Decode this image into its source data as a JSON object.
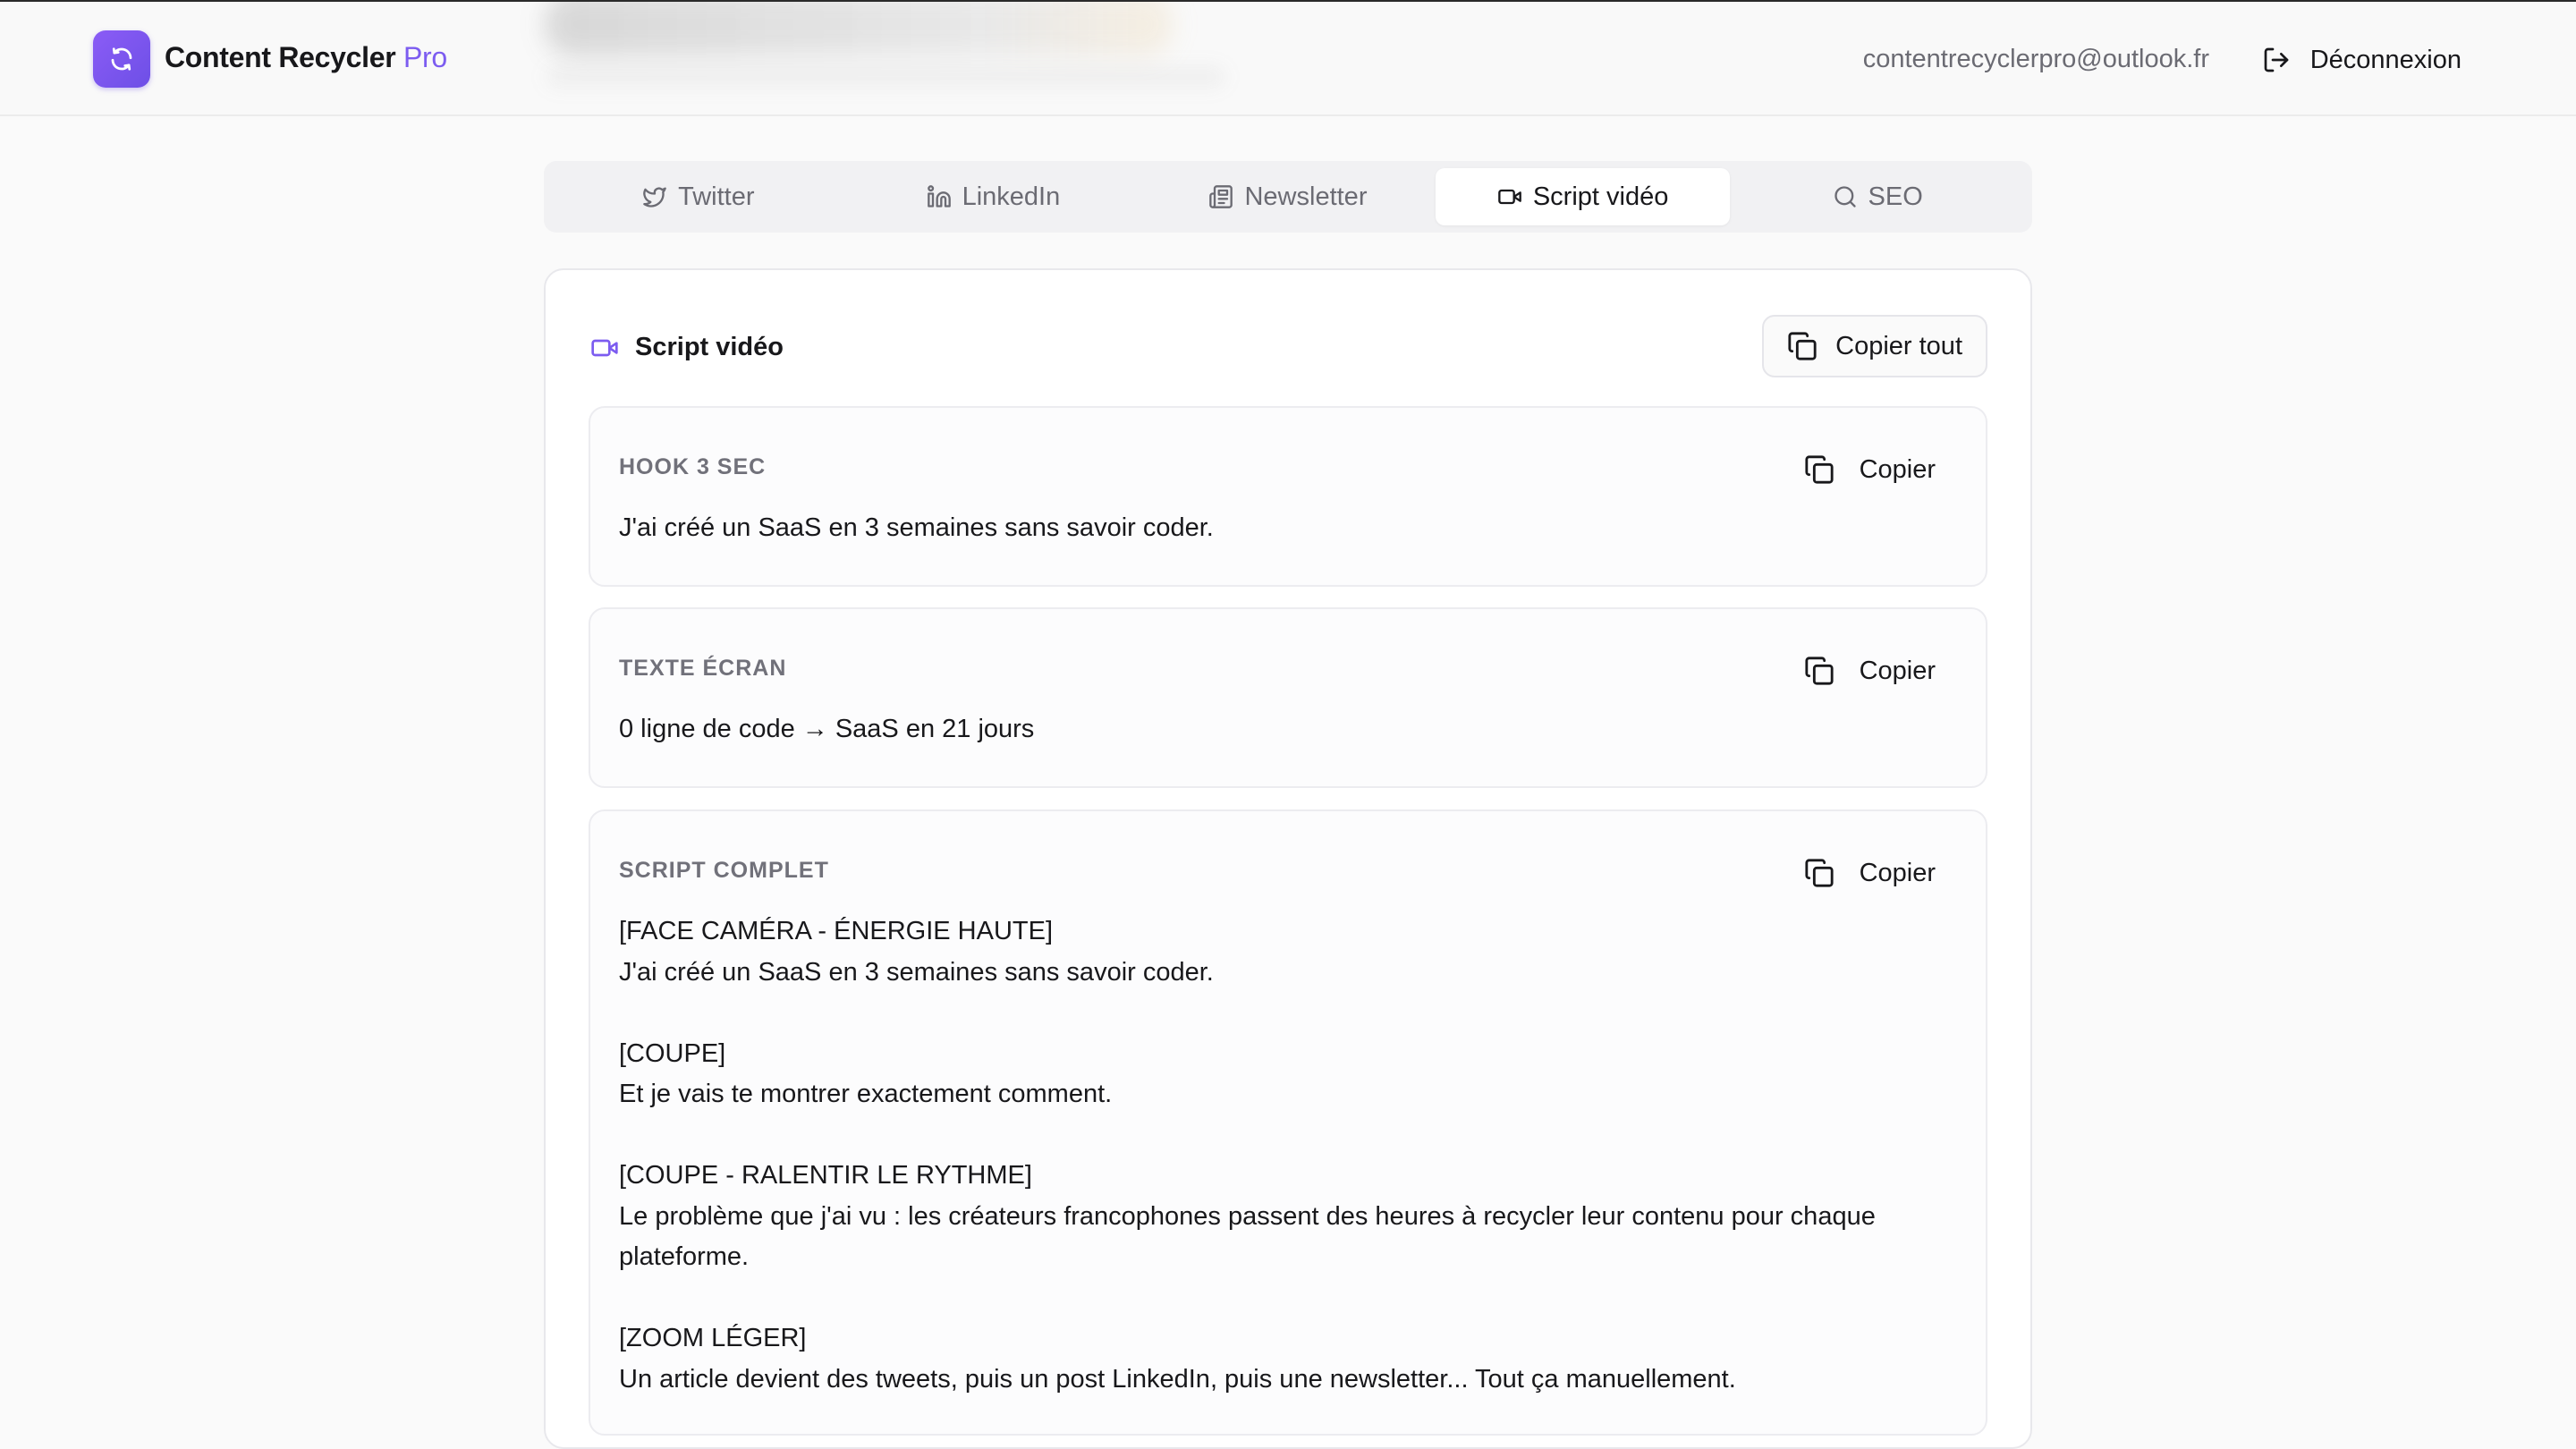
{
  "header": {
    "brand_name": "Content Recycler",
    "brand_suffix": "Pro",
    "logo_icon": "refresh-cycle-icon",
    "user_email": "contentrecyclerpro@outlook.fr",
    "logout_label": "Déconnexion",
    "logout_icon": "logout-icon"
  },
  "tabs": [
    {
      "label": "Twitter",
      "icon": "twitter-bird-icon",
      "active": false
    },
    {
      "label": "LinkedIn",
      "icon": "linkedin-icon",
      "active": false
    },
    {
      "label": "Newsletter",
      "icon": "newspaper-icon",
      "active": false
    },
    {
      "label": "Script vidéo",
      "icon": "video-camera-icon",
      "active": true
    },
    {
      "label": "SEO",
      "icon": "search-icon",
      "active": false
    }
  ],
  "card": {
    "title": "Script vidéo",
    "title_icon": "video-camera-icon",
    "copy_all_label": "Copier tout",
    "sections": [
      {
        "label": "HOOK 3 SEC",
        "copy_label": "Copier",
        "body": "J'ai créé un SaaS en 3 semaines sans savoir coder."
      },
      {
        "label": "TEXTE ÉCRAN",
        "copy_label": "Copier",
        "body": "0 ligne de code → SaaS en 21 jours"
      },
      {
        "label": "SCRIPT COMPLET",
        "copy_label": "Copier",
        "body": "[FACE CAMÉRA - ÉNERGIE HAUTE]\nJ'ai créé un SaaS en 3 semaines sans savoir coder.\n\n[COUPE]\nEt je vais te montrer exactement comment.\n\n[COUPE - RALENTIR LE RYTHME]\nLe problème que j'ai vu : les créateurs francophones passent des heures à recycler leur contenu pour chaque plateforme.\n\n[ZOOM LÉGER]\nUn article devient des tweets, puis un post LinkedIn, puis une newsletter... Tout ça manuellement."
      }
    ]
  },
  "colors": {
    "accent": "#7c5cf0",
    "background": "#fafafa",
    "card": "#ffffff",
    "muted_text": "#71717a"
  }
}
